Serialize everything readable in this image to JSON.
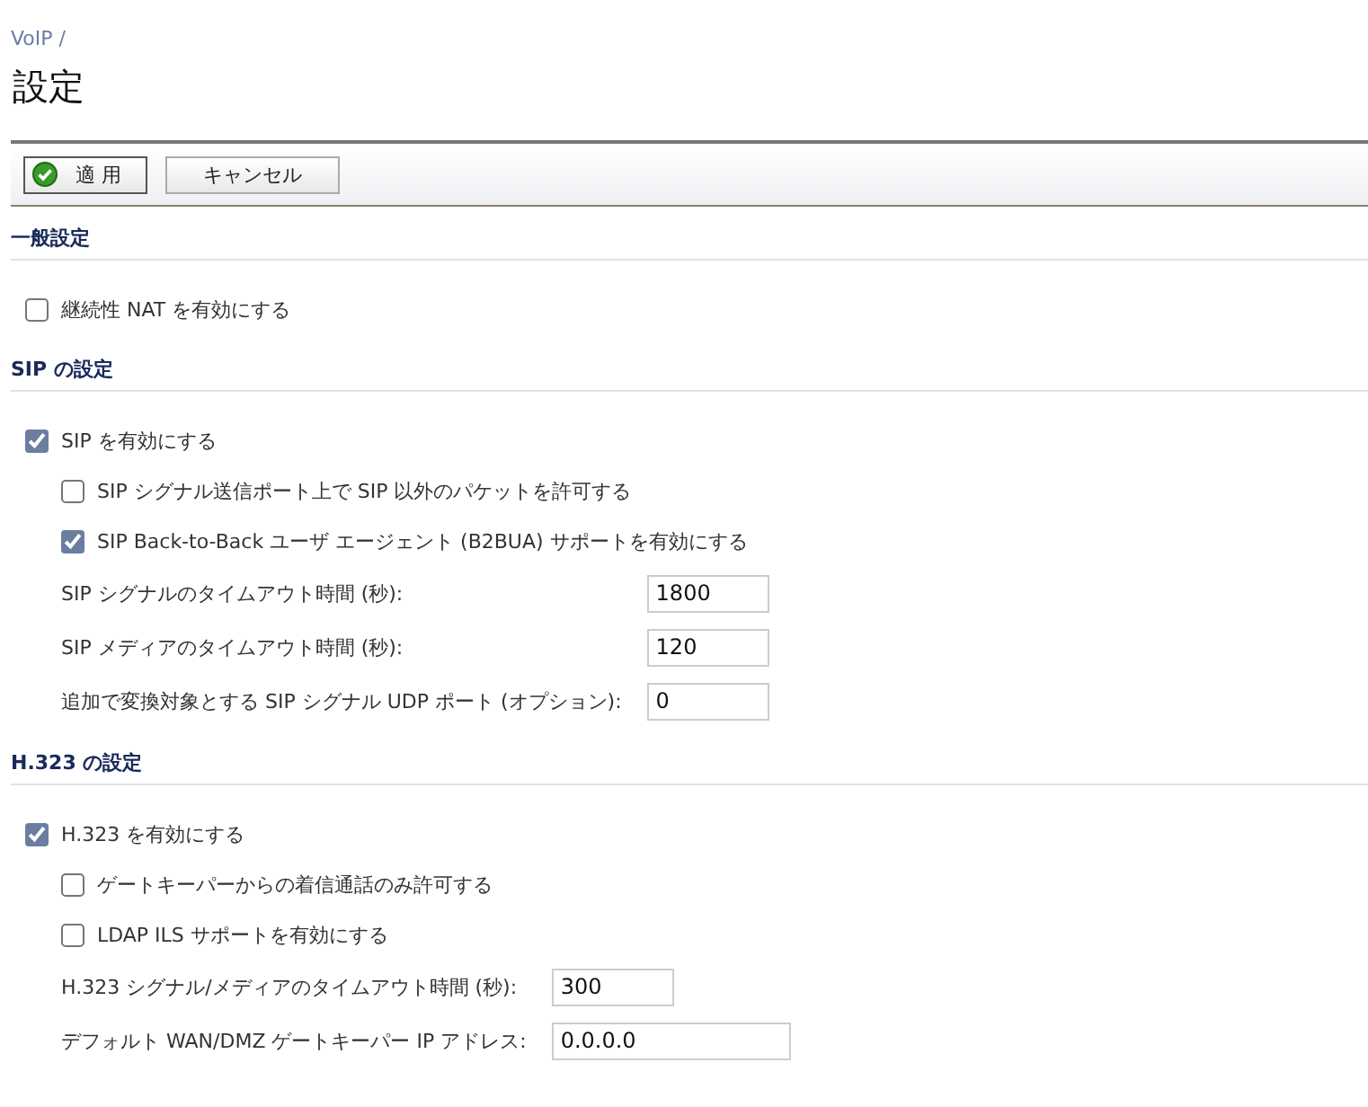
{
  "breadcrumb": "VoIP /",
  "title": "設定",
  "toolbar": {
    "buttons": [
      {
        "label": "適 用",
        "kind": "apply"
      },
      {
        "label": "キャンセル",
        "kind": "cancel"
      }
    ]
  },
  "sections": [
    {
      "title": "一般設定",
      "items": [
        {
          "kind": "checkbox",
          "label": "継続性 NAT を有効にする",
          "checked": false
        }
      ]
    },
    {
      "title": "SIP の設定",
      "items": [
        {
          "kind": "checkbox",
          "label": "SIP を有効にする",
          "checked": true,
          "children": [
            {
              "kind": "checkbox",
              "label": "SIP シグナル送信ポート上で SIP 以外のパケットを許可する",
              "checked": false
            },
            {
              "kind": "checkbox",
              "label": "SIP Back-to-Back ユーザ エージェント (B2BUA) サポートを有効にする",
              "checked": true
            },
            {
              "kind": "field",
              "label": "SIP シグナルのタイムアウト時間 (秒):",
              "value": "1800"
            },
            {
              "kind": "field",
              "label": "SIP メディアのタイムアウト時間 (秒):",
              "value": "120"
            },
            {
              "kind": "field",
              "label": "追加で変換対象とする SIP シグナル UDP ポート (オプション):",
              "value": "0"
            }
          ]
        }
      ]
    },
    {
      "title": "H.323 の設定",
      "items": [
        {
          "kind": "checkbox",
          "label": "H.323 を有効にする",
          "checked": true,
          "children": [
            {
              "kind": "checkbox",
              "label": "ゲートキーパーからの着信通話のみ許可する",
              "checked": false
            },
            {
              "kind": "checkbox",
              "label": "LDAP ILS サポートを有効にする",
              "checked": false
            },
            {
              "kind": "field",
              "label": "H.323 シグナル/メディアのタイムアウト時間 (秒):",
              "value": "300"
            },
            {
              "kind": "field",
              "label": "デフォルト WAN/DMZ ゲートキーパー IP アドレス:",
              "value": "0.0.0.0"
            }
          ]
        }
      ]
    }
  ]
}
